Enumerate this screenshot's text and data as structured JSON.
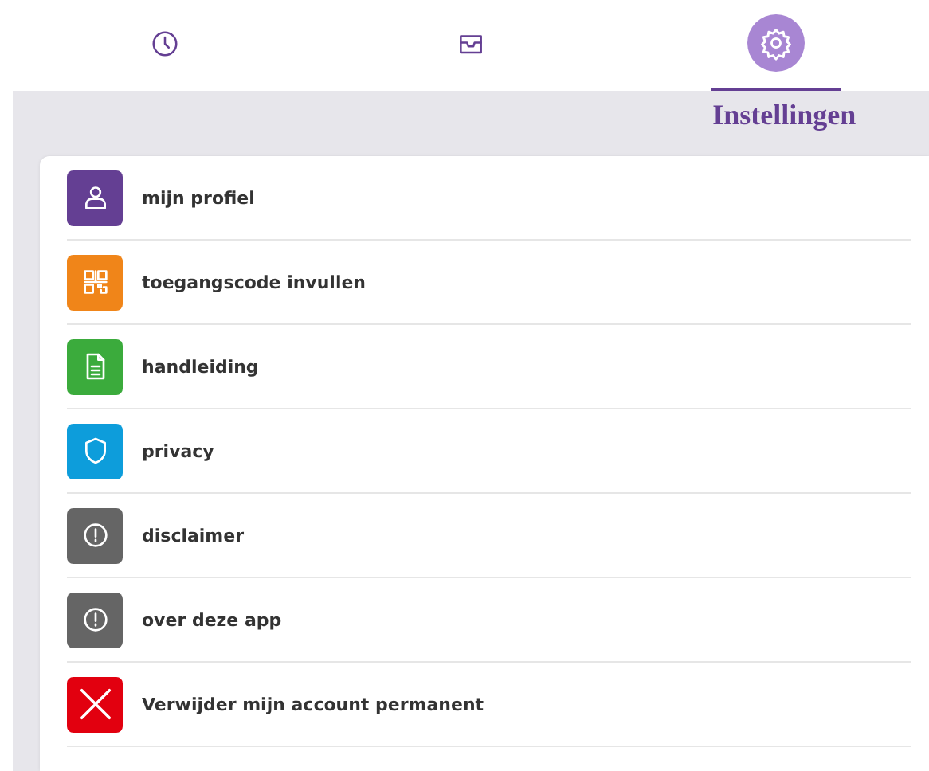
{
  "tabs": [
    {
      "kind": "clock",
      "selected": false
    },
    {
      "kind": "inbox",
      "selected": false
    },
    {
      "kind": "gear",
      "selected": true,
      "label": "Instellingen"
    }
  ],
  "items": [
    {
      "kind": "person",
      "color": "#643f93",
      "label": "mijn profiel"
    },
    {
      "kind": "qr",
      "color": "#f08519",
      "label": "toegangscode invullen"
    },
    {
      "kind": "document",
      "color": "#3bab3c",
      "label": "handleiding"
    },
    {
      "kind": "shield",
      "color": "#0d9ddb",
      "label": "privacy"
    },
    {
      "kind": "alert",
      "color": "#656565",
      "label": "disclaimer"
    },
    {
      "kind": "alert",
      "color": "#656565",
      "label": "over deze app"
    },
    {
      "kind": "cross",
      "color": "#e2000f",
      "label": "Verwijder mijn account permanent"
    }
  ]
}
